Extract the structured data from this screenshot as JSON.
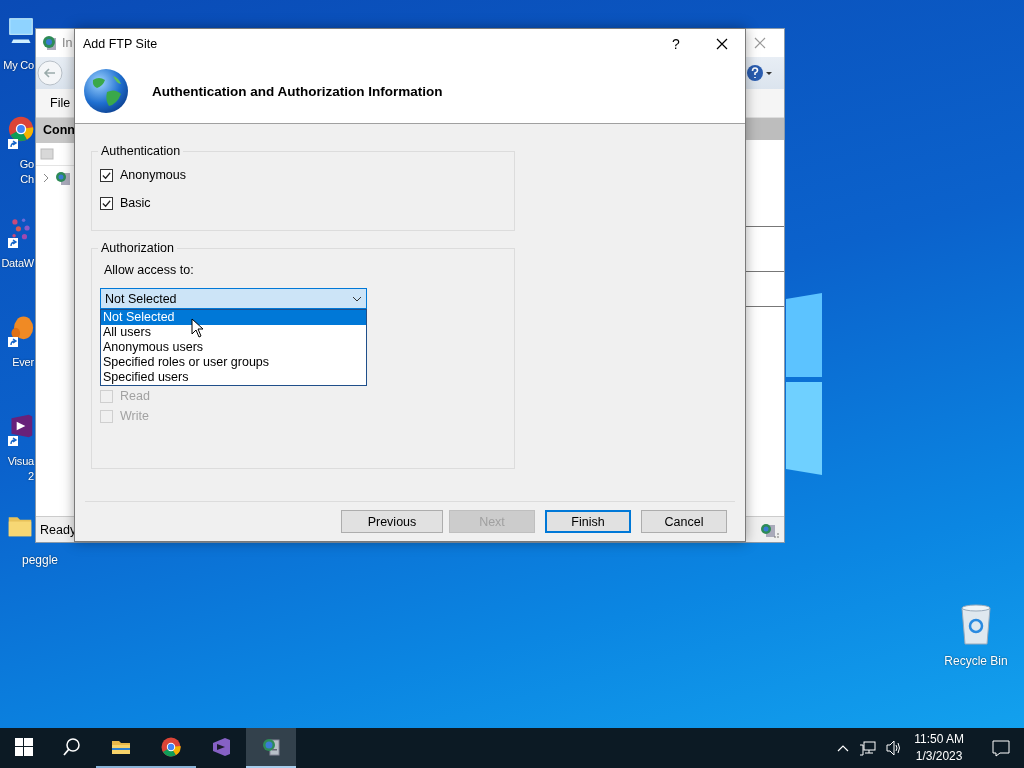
{
  "desktop": {
    "icons": [
      {
        "kind": "computer",
        "shortcut": false,
        "label_lines": [
          "My Co"
        ]
      },
      {
        "kind": "browser",
        "shortcut": true,
        "label_lines": [
          "Go",
          "Ch"
        ]
      },
      {
        "kind": "dots",
        "shortcut": true,
        "label_lines": [
          "DataW"
        ]
      },
      {
        "kind": "elephant",
        "shortcut": true,
        "label_lines": [
          "Ever"
        ]
      },
      {
        "kind": "studio",
        "shortcut": true,
        "label_lines": [
          "Visua",
          "2"
        ]
      },
      {
        "kind": "folder",
        "shortcut": false,
        "label_lines": [
          "peggle"
        ]
      }
    ],
    "recycle_bin": {
      "label": "Recycle Bin"
    }
  },
  "back_window": {
    "title": "In",
    "menu": [
      "File"
    ],
    "pane_header": "Conn",
    "status": "Ready"
  },
  "dialog": {
    "title": "Add FTP Site",
    "help": "?",
    "heading": "Authentication and Authorization Information",
    "authentication": {
      "legend": "Authentication",
      "options": [
        {
          "label": "Anonymous",
          "checked": true,
          "disabled": false
        },
        {
          "label": "Basic",
          "checked": true,
          "disabled": false
        }
      ]
    },
    "authorization": {
      "legend": "Authorization",
      "allow_label": "Allow access to:",
      "combo": {
        "value": "Not Selected",
        "expanded": true,
        "options": [
          {
            "label": "Not Selected",
            "selected": true
          },
          {
            "label": "All users",
            "selected": false
          },
          {
            "label": "Anonymous users",
            "selected": false
          },
          {
            "label": "Specified roles or user groups",
            "selected": false
          },
          {
            "label": "Specified users",
            "selected": false
          }
        ]
      },
      "permissions": [
        {
          "label": "Read",
          "checked": false,
          "disabled": true
        },
        {
          "label": "Write",
          "checked": false,
          "disabled": true
        }
      ]
    },
    "buttons": [
      {
        "label": "Previous",
        "disabled": false,
        "default": false
      },
      {
        "label": "Next",
        "disabled": true,
        "default": false
      },
      {
        "label": "Finish",
        "disabled": false,
        "default": true
      },
      {
        "label": "Cancel",
        "disabled": false,
        "default": false
      }
    ]
  },
  "taskbar": {
    "buttons": [
      {
        "kind": "start",
        "running": false,
        "active": false
      },
      {
        "kind": "search",
        "running": false,
        "active": false
      },
      {
        "kind": "explorer",
        "running": true,
        "active": false
      },
      {
        "kind": "chrome",
        "running": true,
        "active": false
      },
      {
        "kind": "studio",
        "running": false,
        "active": false
      },
      {
        "kind": "server",
        "running": true,
        "active": true
      }
    ],
    "clock": {
      "time": "11:50 AM",
      "date": "1/3/2023"
    }
  }
}
